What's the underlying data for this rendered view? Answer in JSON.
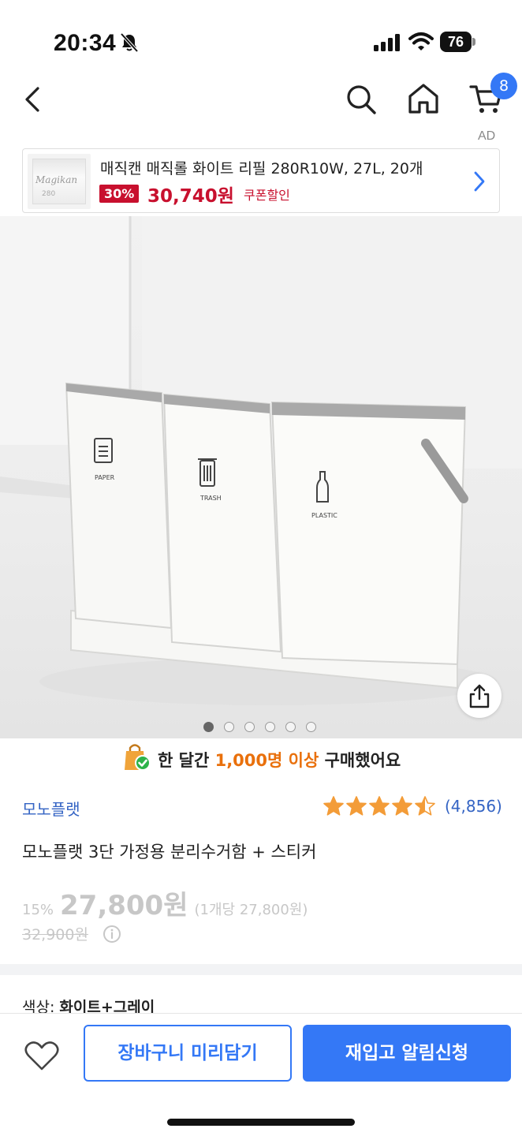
{
  "status_bar": {
    "time": "20:34",
    "battery": "76"
  },
  "nav": {
    "cart_count": "8",
    "ad_label": "AD"
  },
  "ad": {
    "title": "매직캔 매직롤 화이트 리필 280R10W, 27L, 20개",
    "discount": "30%",
    "price": "30,740원",
    "coupon": "쿠폰할인",
    "thumb_logo": "Magikan",
    "thumb_number": "280"
  },
  "hero": {
    "bin_labels": [
      "PAPER",
      "TRASH",
      "PLASTIC"
    ],
    "image_count": 6,
    "active_index": 0
  },
  "social_proof": {
    "prefix": "한 달간 ",
    "highlight": "1,000명 이상",
    "suffix": " 구매했어요"
  },
  "product": {
    "brand": "모노플랫",
    "rating": 4.5,
    "review_count": "(4,856)",
    "name": "모노플랫 3단 가정용 분리수거함 + 스티커",
    "discount_pct": "15%",
    "price": "27,800원",
    "unit_price": "(1개당 27,800원)",
    "original_price": "32,900원"
  },
  "option": {
    "label": "색상:",
    "value": "화이트+그레이"
  },
  "bottom": {
    "cart_button": "장바구니 미리담기",
    "alert_button": "재입고 알림신청"
  },
  "colors": {
    "accent": "#3478f6",
    "sale_red": "#c8102e",
    "highlight_orange": "#e9700c",
    "link_blue": "#3464c4",
    "star": "#f39c38"
  }
}
